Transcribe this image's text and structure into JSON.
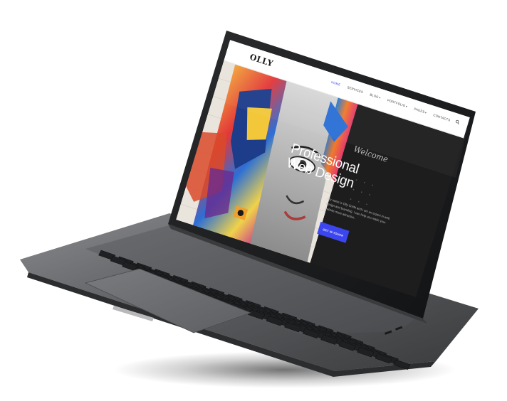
{
  "site": {
    "logo": "OLLY",
    "nav": [
      {
        "label": "HOME",
        "active": true,
        "dropdown": false
      },
      {
        "label": "SERVICES",
        "active": false,
        "dropdown": false
      },
      {
        "label": "BLOG",
        "active": false,
        "dropdown": true
      },
      {
        "label": "PORTFOLIO",
        "active": false,
        "dropdown": true
      },
      {
        "label": "PAGES",
        "active": false,
        "dropdown": true
      },
      {
        "label": "CONTACTS",
        "active": false,
        "dropdown": false
      }
    ],
    "search_icon": "search-icon",
    "hero": {
      "welcome": "Welcome",
      "headline_line1": "Professional",
      "headline_line2": "Web Design",
      "body": "My name is Olly Smith and I am an expert in web design and branding. I can help you make your website more attractive.",
      "cta_label": "GET IN TOUCH"
    }
  },
  "colors": {
    "accent": "#3b46f0",
    "hero_bg": "#1d1d1e",
    "nav_bg": "#ffffff"
  }
}
